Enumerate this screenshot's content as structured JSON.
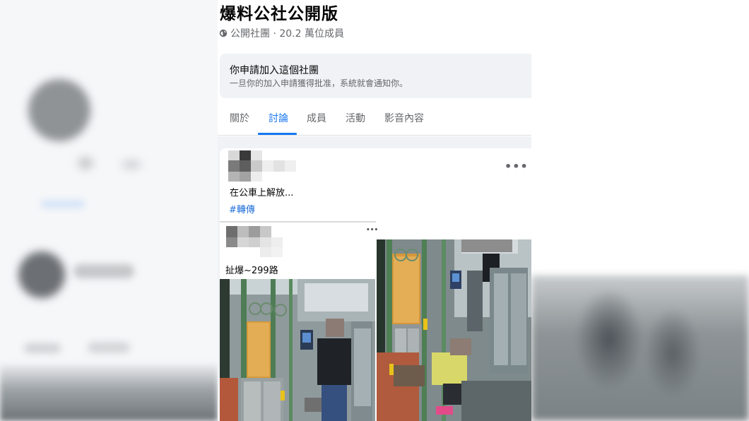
{
  "group": {
    "title": "爆料公社公開版",
    "meta_icon": "globe-icon",
    "meta": "公開社團 · 20.2 萬位成員"
  },
  "join_notice": {
    "title": "你申請加入這個社團",
    "subtitle": "一旦你的加入申請獲得批准，系統就會通知你。"
  },
  "tabs": [
    {
      "label": "關於",
      "active": false
    },
    {
      "label": "討論",
      "active": true
    },
    {
      "label": "成員",
      "active": false
    },
    {
      "label": "活動",
      "active": false
    },
    {
      "label": "影音內容",
      "active": false
    }
  ],
  "post": {
    "more_label": "•••",
    "text": "在公車上解放...",
    "hashtag": "#轉傳"
  },
  "shared_post": {
    "more_label": "•••",
    "caption": "扯爆~299路"
  },
  "colors": {
    "accent": "#1877f2",
    "hashtag": "#216fdb",
    "muted": "#65676b",
    "feed_bg": "#f0f2f5"
  }
}
